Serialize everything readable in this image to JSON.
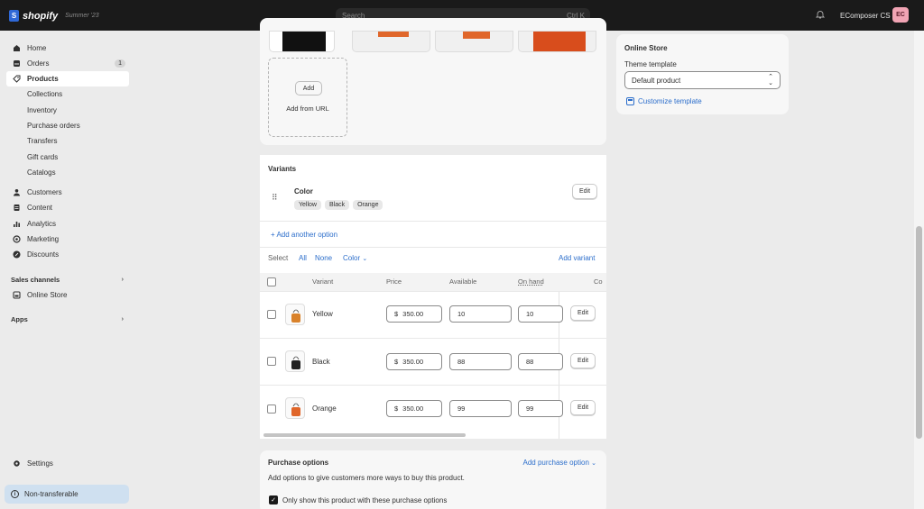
{
  "topbar": {
    "brand": "shopify",
    "edition": "Summer '23",
    "search_placeholder": "Search",
    "search_shortcut": "Ctrl K",
    "store_name": "EComposer CS",
    "avatar_initials": "EC"
  },
  "sidebar": {
    "items": [
      {
        "label": "Home"
      },
      {
        "label": "Orders",
        "badge": "1"
      },
      {
        "label": "Products"
      },
      {
        "label": "Collections"
      },
      {
        "label": "Inventory"
      },
      {
        "label": "Purchase orders"
      },
      {
        "label": "Transfers"
      },
      {
        "label": "Gift cards"
      },
      {
        "label": "Catalogs"
      },
      {
        "label": "Customers"
      },
      {
        "label": "Content"
      },
      {
        "label": "Analytics"
      },
      {
        "label": "Marketing"
      },
      {
        "label": "Discounts"
      }
    ],
    "sales_channels_label": "Sales channels",
    "online_store_label": "Online Store",
    "apps_label": "Apps",
    "settings_label": "Settings",
    "non_transferable_label": "Non-transferable"
  },
  "media": {
    "add_button": "Add",
    "add_from_url": "Add from URL"
  },
  "online_store_card": {
    "title": "Online Store",
    "theme_template_label": "Theme template",
    "theme_template_value": "Default product",
    "customize_link": "Customize template"
  },
  "variants": {
    "title": "Variants",
    "option_name": "Color",
    "option_values": [
      "Yellow",
      "Black",
      "Orange"
    ],
    "edit_label": "Edit",
    "add_another_option": "Add another option",
    "select_label": "Select",
    "select_all": "All",
    "select_none": "None",
    "select_color": "Color",
    "add_variant": "Add variant",
    "columns": [
      "Variant",
      "Price",
      "Available",
      "On hand",
      "Co"
    ],
    "rows": [
      {
        "name": "Yellow",
        "currency": "$",
        "price": "350.00",
        "available": "10",
        "on_hand": "10",
        "edit": "Edit",
        "swatch": "#d9822b"
      },
      {
        "name": "Black",
        "currency": "$",
        "price": "350.00",
        "available": "88",
        "on_hand": "88",
        "edit": "Edit",
        "swatch": "#222222"
      },
      {
        "name": "Orange",
        "currency": "$",
        "price": "350.00",
        "available": "99",
        "on_hand": "99",
        "edit": "Edit",
        "swatch": "#e0662a"
      }
    ]
  },
  "purchase_options": {
    "title": "Purchase options",
    "add_link": "Add purchase option",
    "description": "Add options to give customers more ways to buy this product.",
    "checkbox_label": "Only show this product with these purchase options"
  }
}
